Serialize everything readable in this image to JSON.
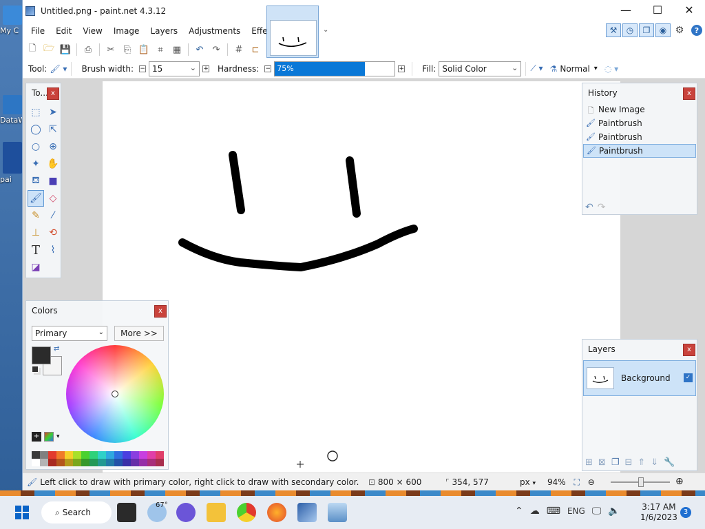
{
  "desktop": {
    "icons": [
      {
        "label": "My C",
        "color": "#3b8ad9"
      },
      {
        "label": "DataW",
        "color": "#2d76c4"
      },
      {
        "label": "pai",
        "color": "#1e4f9c"
      }
    ]
  },
  "window": {
    "title": "Untitled.png - paint.net 4.3.12",
    "controls": {
      "minimize": "—",
      "maximize": "☐",
      "close": "✕"
    }
  },
  "menu": [
    "File",
    "Edit",
    "View",
    "Image",
    "Layers",
    "Adjustments",
    "Effects"
  ],
  "toolbar": {
    "tool_label": "Tool:",
    "brush_width_label": "Brush width:",
    "brush_width_value": "15",
    "hardness_label": "Hardness:",
    "hardness_value": "75%",
    "hardness_fraction": 0.75,
    "fill_label": "Fill:",
    "fill_value": "Solid Color",
    "blend_mode": "Normal"
  },
  "tools_panel": {
    "title": "To...",
    "close": "x"
  },
  "history_panel": {
    "title": "History",
    "close": "x",
    "items": [
      "New Image",
      "Paintbrush",
      "Paintbrush",
      "Paintbrush"
    ],
    "selected_index": 3
  },
  "colors_panel": {
    "title": "Colors",
    "close": "x",
    "mode": "Primary",
    "more_label": "More >>",
    "primary_color": "#2b2b2b",
    "secondary_color": "#f4f4f4",
    "palette_row1": [
      "#3a3a3a",
      "#808080",
      "#e23a2e",
      "#f07a2a",
      "#f5d02a",
      "#a8e02a",
      "#4bd12f",
      "#2fd17a",
      "#2fd1c8",
      "#2fa8e0",
      "#2f6fe0",
      "#4b3fe0",
      "#8a3fe0",
      "#c83fe0",
      "#e03fa8",
      "#e03f6a"
    ],
    "palette_row2": [
      "#ffffff",
      "#b4b4b4",
      "#a82a22",
      "#b4561e",
      "#b49a1e",
      "#7aa81e",
      "#36992a",
      "#229958",
      "#229993",
      "#227aa8",
      "#2252a8",
      "#3a2fa8",
      "#662fa8",
      "#962fa8",
      "#a82f7a",
      "#a82f4e"
    ]
  },
  "layers_panel": {
    "title": "Layers",
    "close": "x",
    "layers": [
      {
        "name": "Background",
        "visible": true
      }
    ]
  },
  "status": {
    "hint": "Left click to draw with primary color, right click to draw with secondary color.",
    "image_size": "800 × 600",
    "cursor_pos": "354, 577",
    "units": "px",
    "zoom": "94%"
  },
  "taskbar": {
    "search_label": "Search",
    "weather_temp": "67°",
    "language": "ENG",
    "time": "3:17 AM",
    "date": "1/6/2023",
    "notification_count": "3"
  }
}
